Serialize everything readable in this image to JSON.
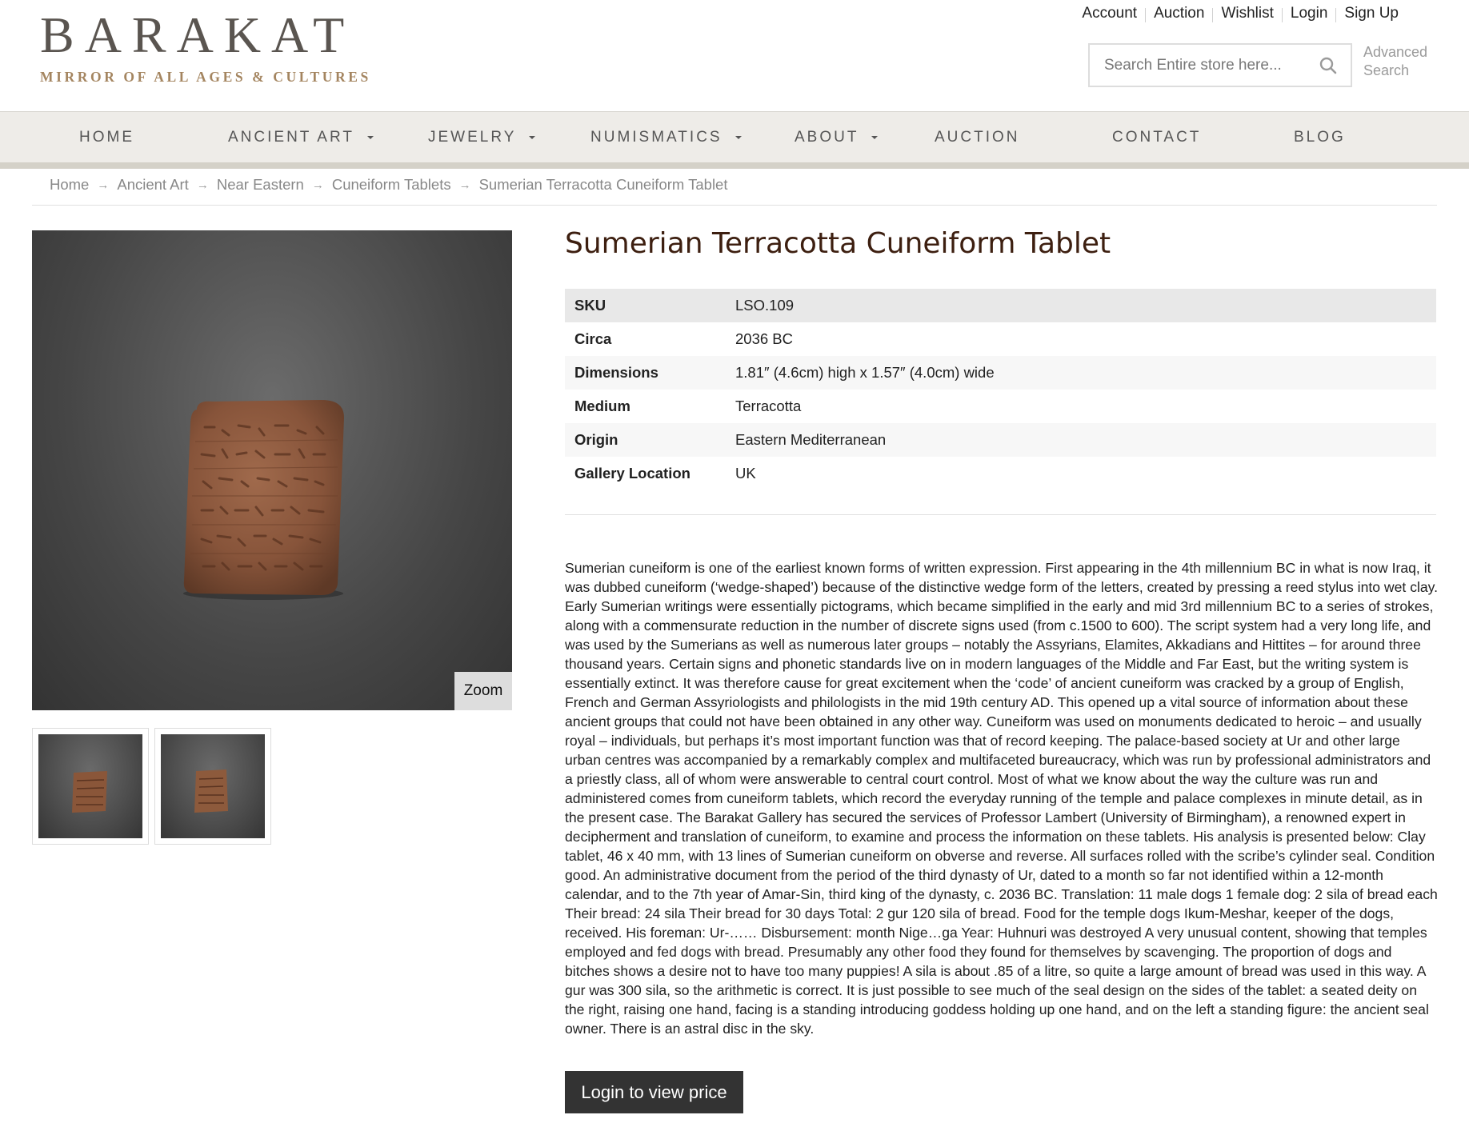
{
  "brand": {
    "name": "BARAKAT",
    "tagline": "MIRROR OF ALL AGES & CULTURES"
  },
  "top_links": [
    "Account",
    "Auction",
    "Wishlist",
    "Login",
    "Sign Up"
  ],
  "search": {
    "placeholder": "Search Entire store here...",
    "advanced_label": "Advanced Search",
    "icon": "search-icon"
  },
  "nav": {
    "items": [
      {
        "label": "HOME",
        "dropdown": false
      },
      {
        "label": "ANCIENT ART",
        "dropdown": true
      },
      {
        "label": "JEWELRY",
        "dropdown": true
      },
      {
        "label": "NUMISMATICS",
        "dropdown": true
      },
      {
        "label": "ABOUT",
        "dropdown": true
      },
      {
        "label": "AUCTION",
        "dropdown": false
      },
      {
        "label": "CONTACT",
        "dropdown": false
      },
      {
        "label": "BLOG",
        "dropdown": false
      }
    ]
  },
  "breadcrumb": [
    "Home",
    "Ancient Art",
    "Near Eastern",
    "Cuneiform Tablets",
    "Sumerian Terracotta Cuneiform Tablet"
  ],
  "gallery": {
    "zoom_label": "Zoom"
  },
  "product": {
    "title": "Sumerian Terracotta Cuneiform Tablet",
    "specs": [
      {
        "key": "SKU",
        "value": "LSO.109"
      },
      {
        "key": "Circa",
        "value": "2036 BC"
      },
      {
        "key": "Dimensions",
        "value": "1.81″ (4.6cm) high x 1.57″ (4.0cm) wide"
      },
      {
        "key": "Medium",
        "value": "Terracotta"
      },
      {
        "key": "Origin",
        "value": "Eastern Mediterranean"
      },
      {
        "key": "Gallery Location",
        "value": "UK"
      }
    ],
    "description": "Sumerian cuneiform is one of the earliest known forms of written expression. First appearing in the 4th millennium BC in what is now Iraq, it was dubbed cuneiform (‘wedge-shaped’) because of the distinctive wedge form of the letters, created by pressing a reed stylus into wet clay. Early Sumerian writings were essentially pictograms, which became simplified in the early and mid 3rd millennium BC to a series of strokes, along with a commensurate reduction in the number of discrete signs used (from c.1500 to 600). The script system had a very long life, and was used by the Sumerians as well as numerous later groups – notably the Assyrians, Elamites, Akkadians and Hittites – for around three thousand years. Certain signs and phonetic standards live on in modern languages of the Middle and Far East, but the writing system is essentially extinct. It was therefore cause for great excitement when the ‘code’ of ancient cuneiform was cracked by a group of English, French and German Assyriologists and philologists in the mid 19th century AD. This opened up a vital source of information about these ancient groups that could not have been obtained in any other way. Cuneiform was used on monuments dedicated to heroic – and usually royal – individuals, but perhaps it’s most important function was that of record keeping. The palace-based society at Ur and other large urban centres was accompanied by a remarkably complex and multifaceted bureaucracy, which was run by professional administrators and a priestly class, all of whom were answerable to central court control. Most of what we know about the way the culture was run and administered comes from cuneiform tablets, which record the everyday running of the temple and palace complexes in minute detail, as in the present case. The Barakat Gallery has secured the services of Professor Lambert (University of Birmingham), a renowned expert in decipherment and translation of cuneiform, to examine and process the information on these tablets. His analysis is presented below: Clay tablet, 46 x 40 mm, with 13 lines of Sumerian cuneiform on obverse and reverse. All surfaces rolled with the scribe’s cylinder seal. Condition good. An administrative document from the period of the third dynasty of Ur, dated to a month so far not identified within a 12-month calendar, and to the 7th year of Amar-Sin, third king of the dynasty, c. 2036 BC. Translation: 11 male dogs 1 female dog: 2 sila of bread each Their bread: 24 sila Their bread for 30 days Total: 2 gur 120 sila of bread. Food for the temple dogs Ikum-Meshar, keeper of the dogs, received. His foreman: Ur-…… Disbursement: month Nige…ga Year: Huhnuri was destroyed A very unusual content, showing that temples employed and fed dogs with bread. Presumably any other food they found for themselves by scavenging. The proportion of dogs and bitches shows a desire not to have too many puppies! A sila is about .85 of a litre, so quite a large amount of bread was used in this way. A gur was 300 sila, so the arithmetic is correct. It is just possible to see much of the seal design on the sides of the tablet: a seated deity on the right, raising one hand, facing is a standing introducing goddess holding up one hand, and on the left a standing figure: the ancient seal owner. There is an astral disc in the sky.",
    "login_button": "Login to view price"
  },
  "colors": {
    "nav_bg": "#eeece8",
    "title": "#3d1f10",
    "tagline": "#a48560",
    "button_bg": "#333333"
  }
}
